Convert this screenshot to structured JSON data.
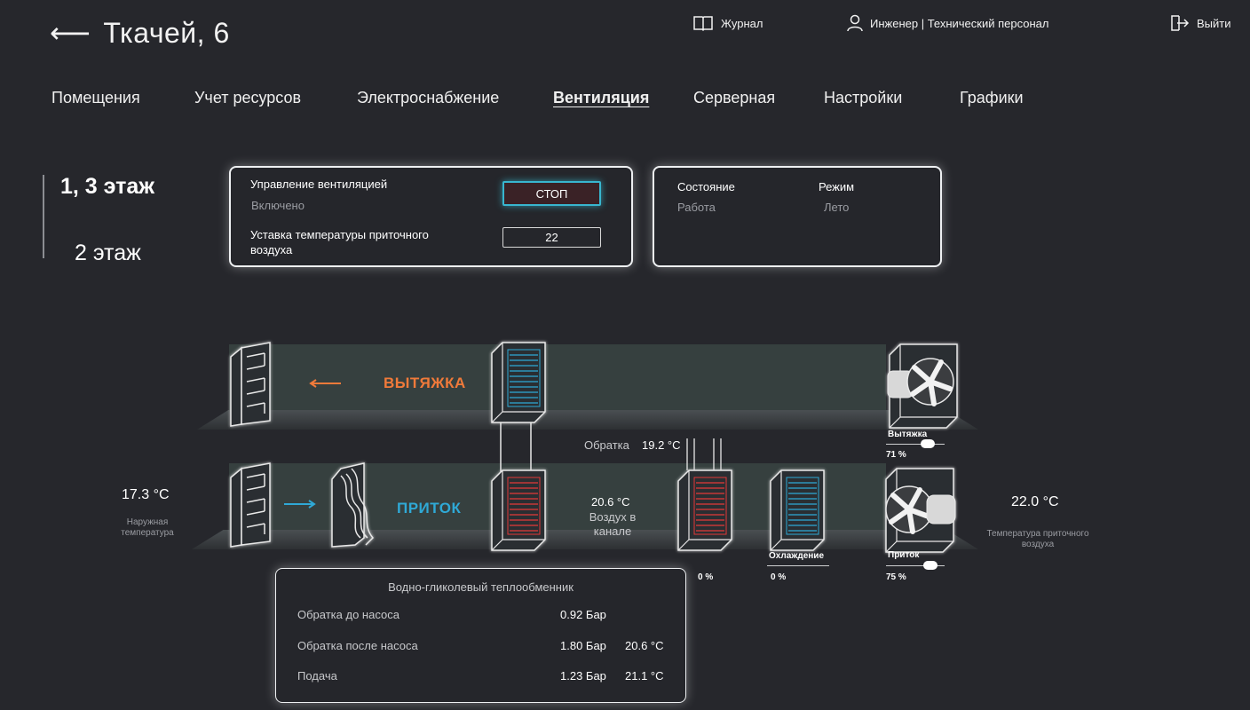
{
  "header": {
    "back_arrow": "⟵",
    "title": "Ткачей, 6",
    "journal": "Журнал",
    "user": "Инженер | Технический персонал",
    "logout": "Выйти"
  },
  "nav": [
    "Помещения",
    "Учет ресурсов",
    "Электроснабжение",
    "Вентиляция",
    "Серверная",
    "Настройки",
    "Графики"
  ],
  "nav_active": "Вентиляция",
  "floors": [
    "1, 3 этаж",
    "2 этаж"
  ],
  "control": {
    "title": "Управление вентиляцией",
    "status": "Включено",
    "stop_label": "СТОП",
    "setpoint_label": "Уставка температуры приточного воздуха",
    "setpoint_value": "22"
  },
  "state": {
    "state_label": "Состояние",
    "state_value": "Работа",
    "mode_label": "Режим",
    "mode_value": "Лето"
  },
  "scheme": {
    "exhaust_label": "ВЫТЯЖКА",
    "supply_label": "ПРИТОК",
    "return_label": "Обратка",
    "return_value": "19.2 °C",
    "outdoor_value": "17.3 °C",
    "outdoor_caption": "Наружная температура",
    "duct_value": "20.6 °C",
    "duct_caption": "Воздух в канале",
    "supply_value": "22.0 °C",
    "supply_caption": "Температура приточного воздуха",
    "exhaust_fan_label": "Вытяжка",
    "exhaust_fan_pct": "71 %",
    "exhaust_fan_level": 0.71,
    "supply_fan_label": "Приток",
    "supply_fan_pct": "75 %",
    "supply_fan_level": 0.75,
    "heater_pct": "0 %",
    "cooling_label": "Охлаждение",
    "cooling_pct": "0 %"
  },
  "exchanger": {
    "title": "Водно-гликолевый теплообменник",
    "rows": [
      {
        "label": "Обратка до насоса",
        "pressure": "0.92 Бар",
        "temp": ""
      },
      {
        "label": "Обратка после насоса",
        "pressure": "1.80 Бар",
        "temp": "20.6 °C"
      },
      {
        "label": "Подача",
        "pressure": "1.23 Бар",
        "temp": "21.1 °C"
      }
    ]
  },
  "colors": {
    "background": "#26272c",
    "exhaust": "#f07a3a",
    "supply": "#2fa9d6",
    "accent": "#38b6cf"
  },
  "icons": [
    "book-icon",
    "user-icon",
    "logout-icon"
  ]
}
